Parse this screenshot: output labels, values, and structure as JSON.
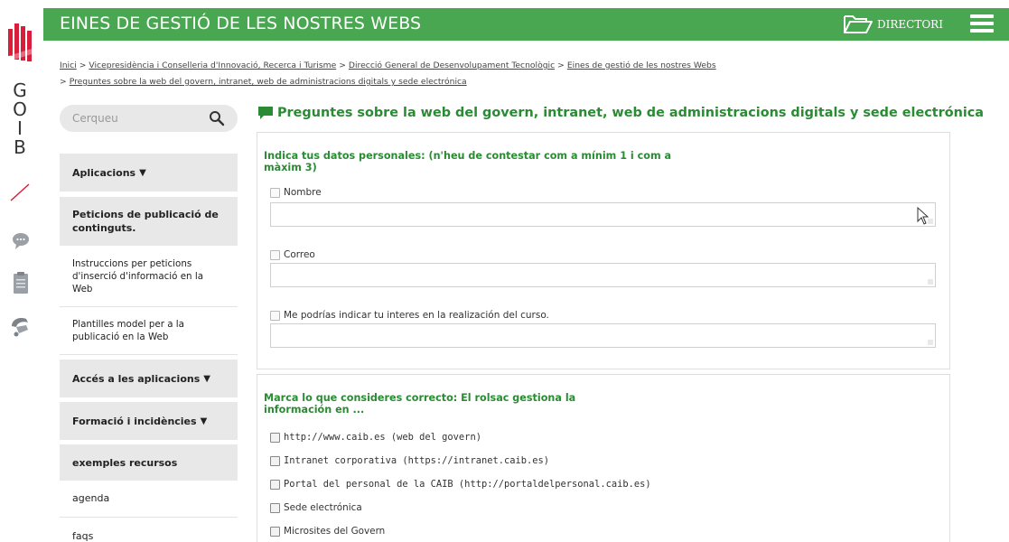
{
  "brand": {
    "letters": [
      "G",
      "O",
      "I",
      "B"
    ],
    "colors": {
      "red": "#d81e3a",
      "green": "#49a751",
      "dark_green": "#2b8a34"
    }
  },
  "header": {
    "title": "EINES DE GESTIÓ DE LES NOSTRES WEBS",
    "directory_label": "DIRECTORI",
    "icons": [
      "folder-open-icon",
      "hamburger-menu-icon"
    ]
  },
  "breadcrumb": {
    "items": [
      "Inici",
      "Vicepresidència i Conselleria d'Innovació, Recerca i Turisme",
      "Direcció General de Desenvolupament Tecnològic",
      "Eines de gestió de les nostres Webs",
      "Preguntes sobre la web del govern, intranet, web de administracions digitals y sede electrónica"
    ],
    "separator": ">"
  },
  "sidebar": {
    "search_placeholder": "Cerqueu",
    "items": [
      {
        "label": "Aplicacions",
        "caret": "▼"
      },
      {
        "label": "Peticions de publicació de continguts."
      },
      {
        "label": "Instruccions per peticions d'inserció d'informació en la Web"
      },
      {
        "label": "Plantilles model per a la publicació en la Web"
      },
      {
        "label": "Accés a les aplicacions",
        "caret": "▼"
      },
      {
        "label": "Formació i incidències",
        "caret": "▼"
      },
      {
        "label": "exemples recursos"
      },
      {
        "label": "agenda"
      },
      {
        "label": "faqs"
      }
    ]
  },
  "main": {
    "title": "Preguntes sobre la web del govern, intranet, web de administracions digitals y sede electrónica",
    "panel1": {
      "title": "Indica tus datos personales: (n'heu de contestar com a mínim 1 i com a màxim 3)",
      "fields": [
        {
          "label": "Nombre",
          "value": ""
        },
        {
          "label": "Correo",
          "value": ""
        },
        {
          "label": "Me podrías indicar tu interes en la realización del curso.",
          "value": ""
        }
      ]
    },
    "panel2": {
      "title": "Marca lo que consideres correcto: El rolsac gestiona la información en ...",
      "options": [
        "http://www.caib.es (web del govern)",
        "Intranet corporativa (https://intranet.caib.es)",
        "Portal del personal de la CAIB (http://portaldelpersonal.caib.es)",
        "Sede electrónica",
        "Microsites del Govern"
      ]
    }
  }
}
